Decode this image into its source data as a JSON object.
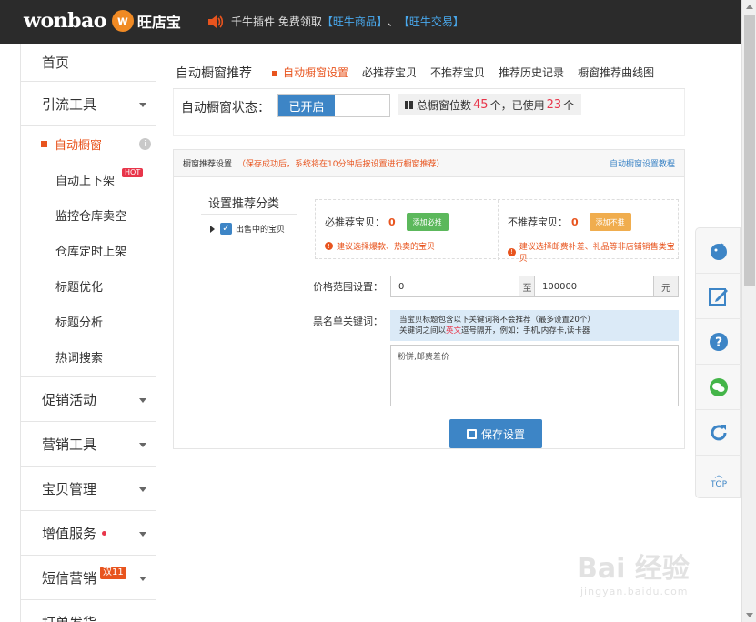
{
  "header": {
    "logo_word": "wonbao",
    "logo_cn": "旺店宝",
    "notice_text": "千牛插件 免费领取",
    "notice_link1": "【旺牛商品】",
    "notice_sep": "、",
    "notice_link2": "【旺牛交易】"
  },
  "sidebar": {
    "home": "首页",
    "traffic": "引流工具",
    "sub": [
      {
        "label": "自动橱窗"
      },
      {
        "label": "自动上下架"
      },
      {
        "label": "监控仓库卖空"
      },
      {
        "label": "仓库定时上架"
      },
      {
        "label": "标题优化"
      },
      {
        "label": "标题分析"
      },
      {
        "label": "热词搜索"
      }
    ],
    "hot_badge": "HOT",
    "promo": "促销活动",
    "marketing": "营销工具",
    "goods": "宝贝管理",
    "value_added": "增值服务",
    "sms": "短信营销",
    "double11": "双11",
    "print": "打单发货"
  },
  "main": {
    "page_title": "自动橱窗推荐",
    "tabs": [
      {
        "label": "自动橱窗设置"
      },
      {
        "label": "必推荐宝贝"
      },
      {
        "label": "不推荐宝贝"
      },
      {
        "label": "推荐历史记录"
      },
      {
        "label": "橱窗推荐曲线图"
      }
    ],
    "status_label": "自动橱窗状态：",
    "toggle_on": "已开启",
    "count_prefix": "总橱窗位数",
    "total": "45",
    "count_mid": "个，已使用",
    "used": "23",
    "count_suffix": "个"
  },
  "panel": {
    "title": "橱窗推荐设置",
    "hint": "（保存成功后，系统将在10分钟后按设置进行橱窗推荐）",
    "tutorial_link": "自动橱窗设置教程",
    "category_title": "设置推荐分类",
    "category_item": "出售中的宝贝",
    "must_label": "必推荐宝贝：",
    "must_count": "0",
    "must_btn": "添加必推",
    "must_tip": "建议选择爆款、热卖的宝贝",
    "no_label": "不推荐宝贝：",
    "no_count": "0",
    "no_btn": "添加不推",
    "no_tip": "建议选择邮费补差、礼品等非店铺销售类宝贝",
    "price_label": "价格范围设置：",
    "price_min": "0",
    "price_to": "至",
    "price_max": "100000",
    "price_unit": "元",
    "blacklist_label": "黑名单关键词：",
    "blacklist_hint1": "当宝贝标题包含以下关键词将不会推荐（最多设置20个）",
    "blacklist_hint2a": "关键词之间以",
    "blacklist_hint2b": "英文",
    "blacklist_hint2c": "逗号隔开，例如：手机,内存卡,读卡器",
    "blacklist_value": "粉饼,邮费差价",
    "save": "保存设置"
  },
  "float_tools": {
    "top": "TOP"
  },
  "watermark": {
    "main": "Bai 经验",
    "sub": "jingyan.baidu.com"
  },
  "colors": {
    "accent": "#e8541e",
    "primary": "#3d85c6",
    "topbar": "#2b2b2b"
  }
}
